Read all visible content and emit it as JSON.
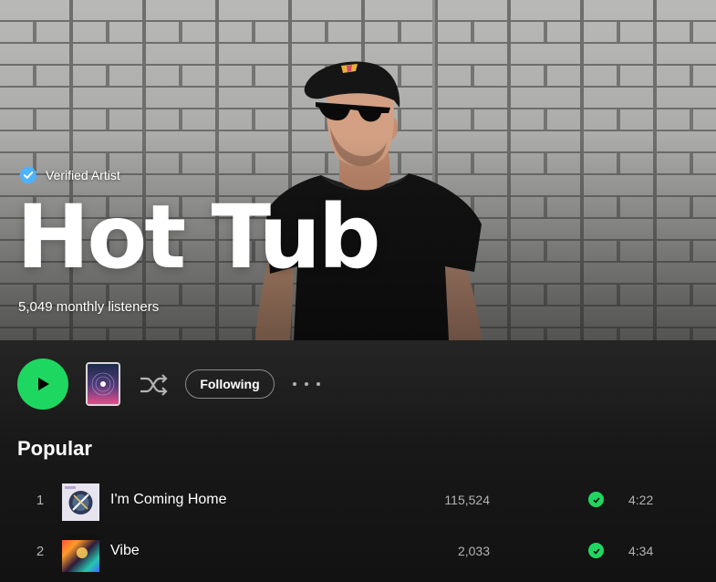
{
  "artist": {
    "verified_label": "Verified Artist",
    "name": "Hot Tub",
    "monthly_listeners": "5,049 monthly listeners"
  },
  "actions": {
    "play_icon": "play-icon",
    "shuffle_icon": "shuffle-icon",
    "follow_label": "Following",
    "more_icon": "more-options-icon"
  },
  "popular": {
    "title": "Popular",
    "tracks": [
      {
        "number": "1",
        "title": "I'm Coming Home",
        "plays": "115,524",
        "duration": "4:22"
      },
      {
        "number": "2",
        "title": "Vibe",
        "plays": "2,033",
        "duration": "4:34"
      }
    ]
  },
  "colors": {
    "accent": "#1ed760",
    "background": "#121212",
    "verified_blue": "#4cb3ff"
  }
}
